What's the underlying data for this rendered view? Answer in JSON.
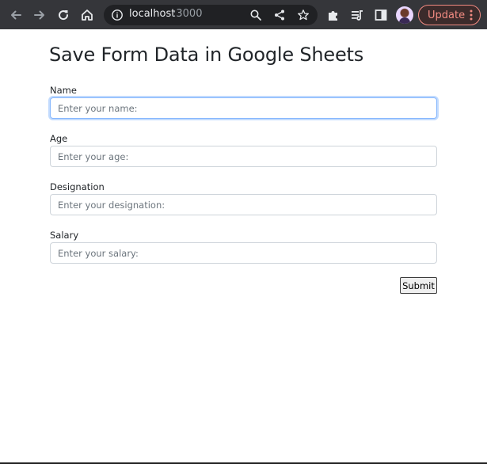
{
  "browser": {
    "url_host": "localhost",
    "url_port": ":3000",
    "update_label": "Update",
    "toolbar_bg": "#35363a",
    "icons": [
      "back-arrow-icon",
      "forward-arrow-icon",
      "reload-icon",
      "home-icon",
      "info-icon",
      "zoom-icon",
      "share-icon",
      "star-icon",
      "extensions-icon",
      "reading-list-icon",
      "side-panel-icon",
      "profile-avatar",
      "more-vert-icon"
    ]
  },
  "form": {
    "title": "Save Form Data in Google Sheets",
    "fields": [
      {
        "label": "Name",
        "placeholder": "Enter your name:",
        "value": ""
      },
      {
        "label": "Age",
        "placeholder": "Enter your age:",
        "value": ""
      },
      {
        "label": "Designation",
        "placeholder": "Enter your designation:",
        "value": ""
      },
      {
        "label": "Salary",
        "placeholder": "Enter your salary:",
        "value": ""
      }
    ],
    "submit_label": "Submit",
    "focus_color": "#86b7fe"
  }
}
